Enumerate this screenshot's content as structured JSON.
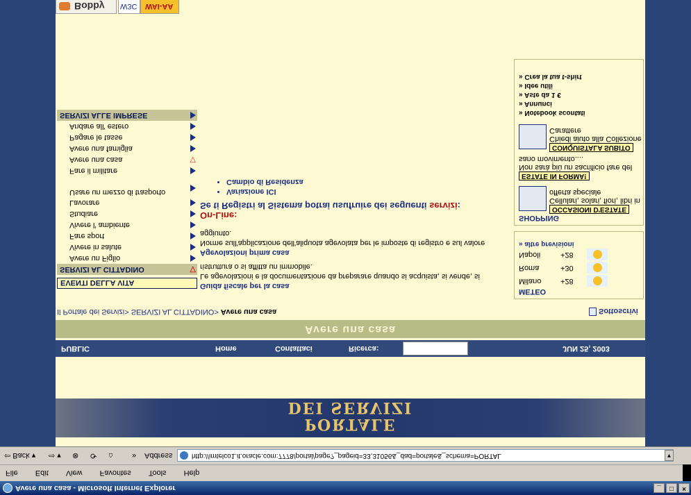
{
  "window": {
    "title": "Avere una casa - Microsoft Internet Explorer",
    "menu": [
      "File",
      "Edit",
      "View",
      "Favorites",
      "Tools",
      "Help"
    ],
    "toolbar": {
      "back": "Back",
      "address_label": "Address",
      "url": "http://imtelco1.it.oracle.com:7778/portal/page?_pageid=33,31056&_dad=portale&_schema=PORTAL"
    }
  },
  "banner": {
    "line1": "PORTALE",
    "line2": "DEI SERVIZI"
  },
  "nav": {
    "public": "PUBLIC",
    "home": "Home",
    "contacts": "Contattaci",
    "search_label": "Ricerca:",
    "date": "JUN 25, 2003"
  },
  "page_title": "Avere una casa",
  "breadcrumb": {
    "root": "Il Portale dei Servizi",
    "sep1": "> ",
    "section": "SERVIZI AL CITTADINO",
    "sep2": "> ",
    "current": "Avere una casa"
  },
  "subscribe": "Sottoscrivi",
  "left_menu": {
    "events_head": "EVENTI DELLA VITA",
    "citizen_head": "SERVIZI AL CITTADINO",
    "citizen_items": [
      "Avere un Figlio",
      "Vivere in salute",
      "Fare sport",
      "Vivere l' ambiente",
      "Studiare",
      "Lavorare",
      "Usare un mezzo di trasporto",
      "Fare il militare",
      "Avere una casa",
      "Avere una famiglia",
      "Pagare le tasse",
      "Andare all' estero"
    ],
    "business_head": "SERVIZI ALLE IMPRESE"
  },
  "content": {
    "link1": "Guida fiscale per la casa",
    "desc1": "Le agevolazioni e la documentazione da preparare quando si acquista, si vende, si ristruttura o si affitta un immobile.",
    "link2": "Agevolazioni prima casa",
    "desc2": "Norme sull'applicazione dell'aliquota agevolata per le imposte di registro e sul valore aggiunto.",
    "online_label": "On-Line:",
    "register_text": "Se ti Registri al Sistema potrai usufruire dei seguenti",
    "register_red": "servizi",
    "register_colon": ":",
    "services": [
      "Variazione ICI",
      "Cambio di Residenza"
    ]
  },
  "meteo": {
    "head": "METEO",
    "rows": [
      {
        "city": "Milano",
        "temp": "+28"
      },
      {
        "city": "Roma",
        "temp": "+30"
      },
      {
        "city": "Napoli",
        "temp": "+28"
      }
    ],
    "more": "» altre previsioni"
  },
  "shopping": {
    "head": "SHOPPING",
    "item1_btn": "OCCASIONI D'ESTATE",
    "item1_text": "Cellulari, solari, fiori, libri in offerta speciale",
    "item2_btn": "ESTATE IN FORMA!",
    "item2_text": "Non sarà più un sacrificio fare del sano movimento....",
    "item3_btn": "CONQUISTALA SUBITO",
    "item3_text": "Chiedi aiuto alla Collezione Carattere",
    "links": [
      "» Notebook scontati",
      "» Annunci",
      "» Aste da 1 €",
      "» Idee utili",
      "» Crea la tua t-shirt"
    ]
  },
  "partner": {
    "b1": "Bobby",
    "b2": "W3C",
    "b3": "WAI-AA"
  }
}
